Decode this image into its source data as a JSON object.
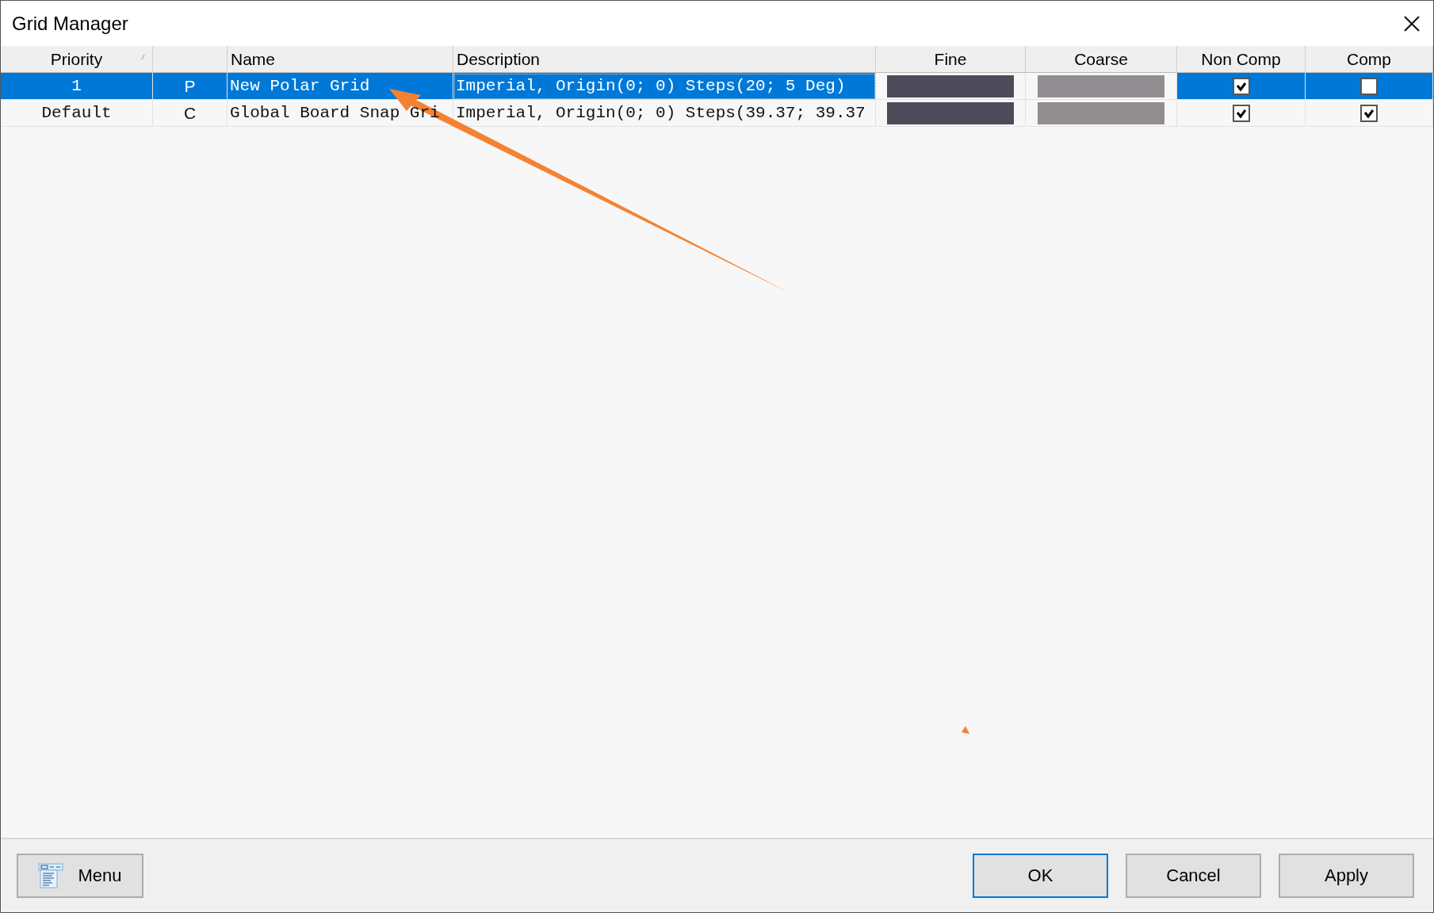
{
  "window": {
    "title": "Grid Manager"
  },
  "table": {
    "columns": [
      {
        "label": "Priority",
        "sorted": true
      },
      {},
      {
        "label": "Name"
      },
      {
        "label": "Description"
      },
      {
        "label": "Fine"
      },
      {
        "label": "Coarse"
      },
      {
        "label": "Non Comp"
      },
      {
        "label": "Comp"
      }
    ],
    "rows": [
      {
        "selected": true,
        "priority": "1",
        "type": "P",
        "name": "New Polar Grid",
        "description": "Imperial, Origin(0; 0) Steps(20; 5 Deg)",
        "fine": {
          "color": "#4d4b5a"
        },
        "coarse": {
          "color": "#918d90"
        },
        "non_comp": {
          "checked": true
        },
        "comp": {
          "checked": false
        }
      },
      {
        "selected": false,
        "priority": "Default",
        "type": "C",
        "name": "Global Board Snap Gri",
        "description": "Imperial, Origin(0; 0) Steps(39.37; 39.37",
        "fine": {
          "color": "#4d4b5a"
        },
        "coarse": {
          "color": "#918d90"
        },
        "non_comp": {
          "checked": true
        },
        "comp": {
          "checked": true
        }
      }
    ]
  },
  "buttons": [
    {
      "label": "Menu",
      "kind": "menu"
    },
    {
      "label": "OK",
      "kind": "default"
    },
    {
      "label": "Cancel",
      "kind": "normal"
    },
    {
      "label": "Apply",
      "kind": "normal"
    }
  ]
}
